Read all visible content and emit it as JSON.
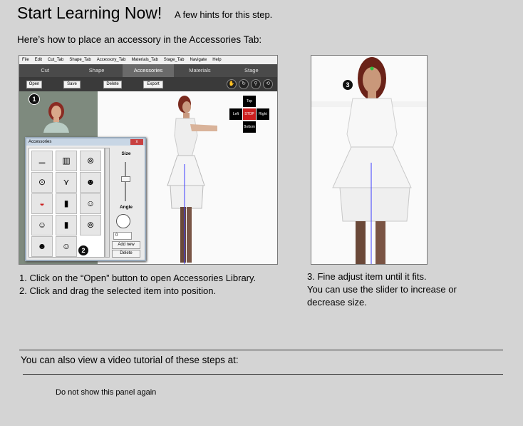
{
  "header": {
    "title": "Start Learning Now!",
    "subtitle": "A few hints for this step."
  },
  "intro": "Here’s how to place an accessory in the Accessories Tab:",
  "app_shot": {
    "menu": [
      "File",
      "Edit",
      "Cut_Tab",
      "Shape_Tab",
      "Accessory_Tab",
      "Materials_Tab",
      "Stage_Tab",
      "Navigate",
      "Help"
    ],
    "tabs": [
      "Cut",
      "Shape",
      "Accessories",
      "Materials",
      "Stage"
    ],
    "active_tab": "Accessories",
    "toolbar": {
      "open": "Open",
      "save": "Save",
      "delete": "Delete",
      "export": "Export"
    },
    "dpad": {
      "top": "Top",
      "left": "Left",
      "stop": "STOP",
      "right": "Right",
      "bottom": "Bottom"
    },
    "badges": {
      "one": "1",
      "two": "2"
    },
    "dialog": {
      "title": "Accessories",
      "close": "x",
      "size_label": "Size",
      "angle_label": "Angle",
      "angle_value": "0",
      "add_new": "Add new",
      "delete": "Delete"
    }
  },
  "right_shot": {
    "badge": "3"
  },
  "steps_left": [
    "1. Click on the “Open” button to open Accessories Library.",
    "2. Click and drag the selected item into position."
  ],
  "steps_right": [
    "3. Fine adjust item until it fits.",
    "You can use the slider to increase or",
    "decrease size."
  ],
  "footer": {
    "video_text": "You can also view a video tutorial of these steps at:",
    "hide_panel": "Do not show this panel again"
  },
  "colors": {
    "background": "#d4d4d4",
    "tab_bar": "#4a4a4a",
    "stop": "#cc1f1f"
  }
}
